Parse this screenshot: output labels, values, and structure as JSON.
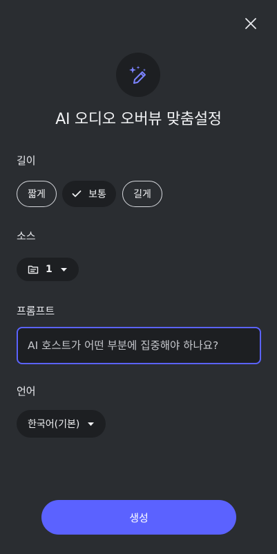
{
  "dialog": {
    "title": "AI 오디오 오버뷰 맞춤설정",
    "close_icon": "close-icon",
    "header_icon": "magic-wand-sparkles-icon"
  },
  "length": {
    "label": "길이",
    "options": [
      {
        "label": "짧게",
        "selected": false
      },
      {
        "label": "보통",
        "selected": true
      },
      {
        "label": "길게",
        "selected": false
      }
    ]
  },
  "sources": {
    "label": "소스",
    "count": "1",
    "icon": "source-list-icon"
  },
  "prompt": {
    "label": "프롬프트",
    "value": "",
    "placeholder": "AI 호스트가 어떤 부분에 집중해야 하나요?"
  },
  "language": {
    "label": "언어",
    "selected": "한국어(기본)"
  },
  "actions": {
    "generate_label": "생성"
  },
  "colors": {
    "background": "#2a2d31",
    "accent": "#5b62ff",
    "surface": "#1d1f22"
  }
}
